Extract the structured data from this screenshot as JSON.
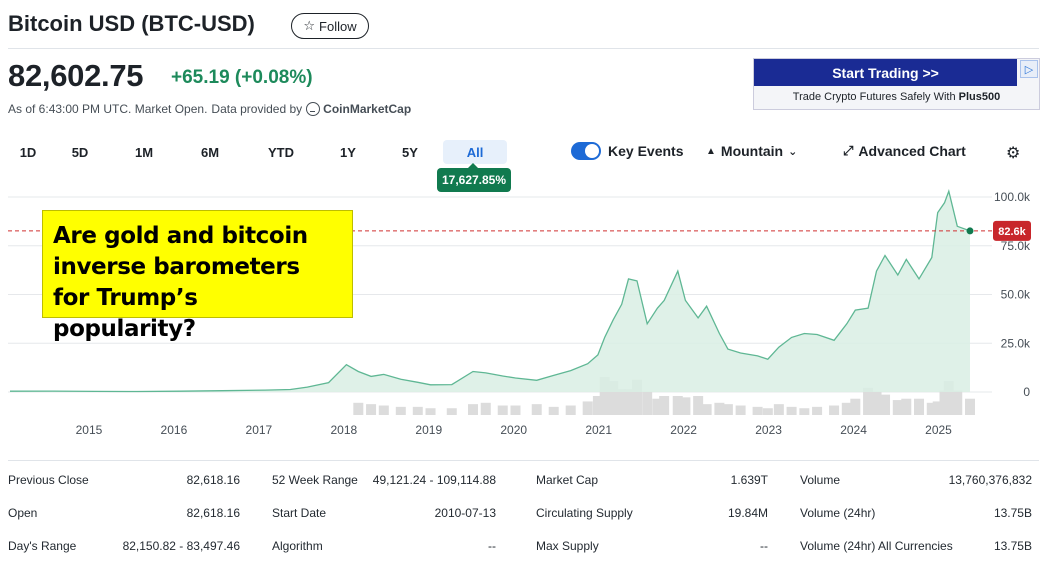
{
  "header": {
    "title": "Bitcoin USD (BTC-USD)",
    "follow_label": "Follow",
    "price": "82,602.75",
    "change": "+65.19 (+0.08%)",
    "as_of": "As of 6:43:00 PM UTC. Market Open.",
    "provided_by": "Data provided by",
    "provider": "CoinMarketCap"
  },
  "ad": {
    "button": "Start Trading >>",
    "text_prefix": "Trade Crypto Futures Safely With ",
    "brand": "Plus500",
    "info_icon": "ad-info-icon"
  },
  "ranges": [
    "1D",
    "5D",
    "1M",
    "6M",
    "YTD",
    "1Y",
    "5Y",
    "All"
  ],
  "active_range": "All",
  "range_change_badge": "17,627.85%",
  "toolbar": {
    "key_events_label": "Key Events",
    "key_events_on": true,
    "chart_type_label": "Mountain",
    "advanced_label": "Advanced Chart",
    "settings_icon": "gear-icon"
  },
  "callout_text": "Are gold and bitcoin inverse barometers for Trump’s popularity?",
  "chart_data": {
    "type": "area",
    "x_tick_labels": [
      "2015",
      "2016",
      "2017",
      "2018",
      "2019",
      "2020",
      "2021",
      "2022",
      "2023",
      "2024",
      "2025"
    ],
    "y_tick_labels": [
      "100.0k",
      "75.0k",
      "50.0k",
      "25.0k",
      "0"
    ],
    "ylim": [
      0,
      100000
    ],
    "current_price_label": "82.6k",
    "current_price": 82602.75,
    "colors": {
      "line": "#5fb794",
      "fill": "#d9eee4",
      "current_line": "#d03131",
      "badge": "#c8262b",
      "volume": "#dcdcdc"
    },
    "x": [
      2014.0,
      2014.5,
      2015.0,
      2015.5,
      2016.0,
      2016.5,
      2017.0,
      2017.3,
      2017.5,
      2017.75,
      2017.96,
      2018.1,
      2018.25,
      2018.4,
      2018.6,
      2018.8,
      2018.95,
      2019.2,
      2019.45,
      2019.6,
      2019.8,
      2019.95,
      2020.2,
      2020.4,
      2020.6,
      2020.8,
      2020.92,
      2021.0,
      2021.1,
      2021.2,
      2021.28,
      2021.38,
      2021.5,
      2021.62,
      2021.7,
      2021.86,
      2021.95,
      2022.1,
      2022.2,
      2022.35,
      2022.45,
      2022.6,
      2022.8,
      2022.92,
      2023.05,
      2023.2,
      2023.35,
      2023.5,
      2023.7,
      2023.85,
      2023.95,
      2024.1,
      2024.2,
      2024.3,
      2024.45,
      2024.55,
      2024.7,
      2024.85,
      2024.92,
      2025.0,
      2025.05,
      2025.15,
      2025.3
    ],
    "values": [
      400,
      450,
      300,
      280,
      430,
      650,
      1000,
      1300,
      2500,
      4800,
      14000,
      10500,
      8000,
      9000,
      6500,
      5000,
      3700,
      3800,
      10500,
      9800,
      8200,
      7200,
      6000,
      8500,
      11000,
      14500,
      19000,
      28000,
      37000,
      45000,
      58000,
      57000,
      35000,
      43000,
      47000,
      62000,
      47000,
      38000,
      44000,
      30000,
      22000,
      20000,
      18500,
      16800,
      23000,
      28000,
      30000,
      29500,
      26500,
      35000,
      42000,
      43000,
      62000,
      70000,
      60000,
      68000,
      58000,
      69000,
      92000,
      97000,
      103000,
      85000,
      82600
    ],
    "volume": [
      0,
      0,
      0,
      0,
      0,
      0,
      0,
      0,
      0,
      0,
      0,
      9,
      8,
      7,
      6,
      6,
      5,
      5,
      8,
      9,
      7,
      7,
      8,
      6,
      7,
      10,
      14,
      28,
      25,
      19,
      19,
      26,
      17,
      12,
      14,
      14,
      13,
      14,
      8,
      9,
      8,
      7,
      6,
      5,
      8,
      6,
      5,
      6,
      7,
      9,
      12,
      20,
      17,
      15,
      11,
      12,
      12,
      9,
      10,
      18,
      25,
      18,
      12
    ]
  },
  "stats": [
    [
      [
        "Previous Close",
        "82,618.16"
      ],
      [
        "Open",
        "82,618.16"
      ],
      [
        "Day's Range",
        "82,150.82 - 83,497.46"
      ]
    ],
    [
      [
        "52 Week Range",
        "49,121.24 - 109,114.88"
      ],
      [
        "Start Date",
        "2010-07-13"
      ],
      [
        "Algorithm",
        "--"
      ]
    ],
    [
      [
        "Market Cap",
        "1.639T"
      ],
      [
        "Circulating Supply",
        "19.84M"
      ],
      [
        "Max Supply",
        "--"
      ]
    ],
    [
      [
        "Volume",
        "13,760,376,832"
      ],
      [
        "Volume (24hr)",
        "13.75B"
      ],
      [
        "Volume (24hr) All Currencies",
        "13.75B"
      ]
    ]
  ]
}
